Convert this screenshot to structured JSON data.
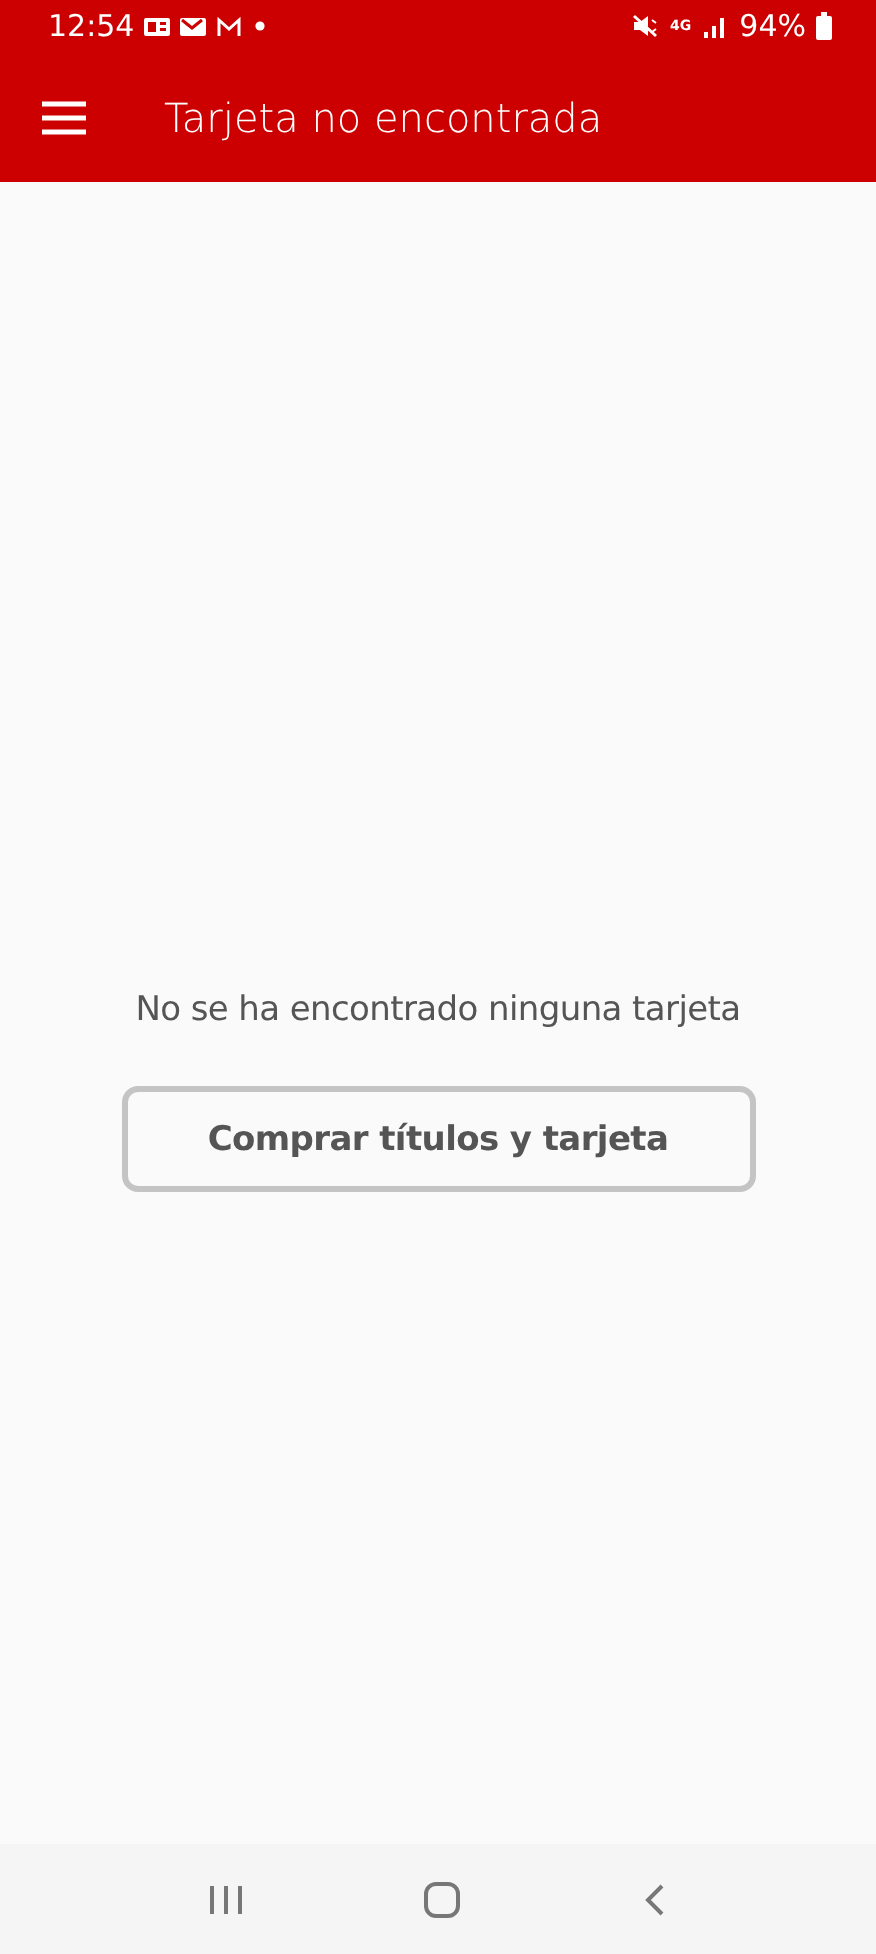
{
  "status_bar": {
    "time": "12:54",
    "network": "4G",
    "battery": "94%"
  },
  "app_bar": {
    "title": "Tarjeta no encontrada"
  },
  "content": {
    "message": "No se ha encontrado ninguna tarjeta",
    "button": "Comprar títulos y tarjeta"
  }
}
